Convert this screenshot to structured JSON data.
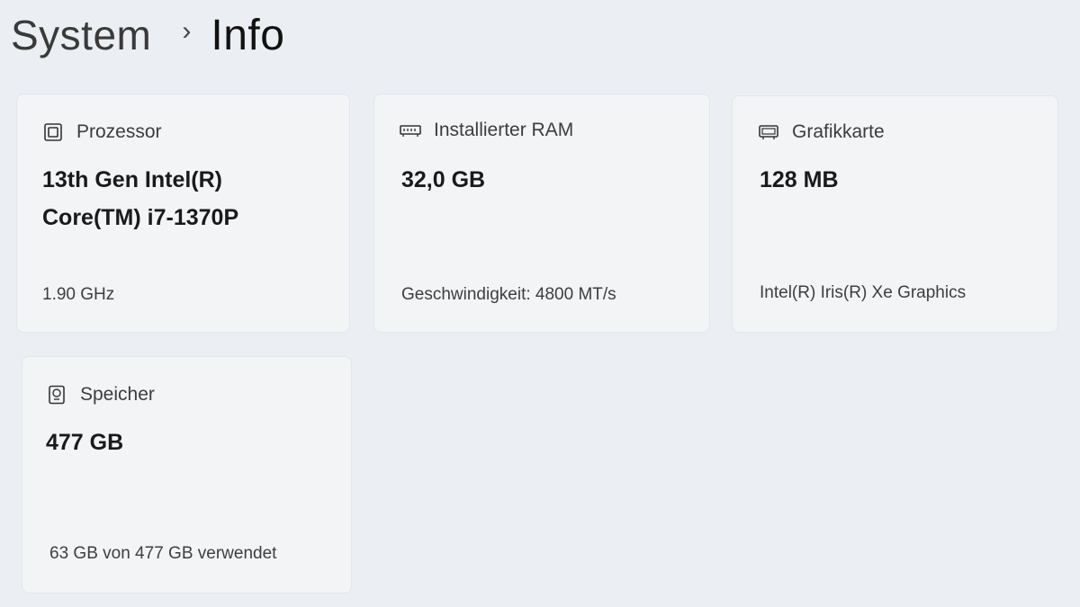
{
  "breadcrumb": {
    "parent": "System",
    "separator": "›",
    "current": "Info"
  },
  "cards": {
    "processor": {
      "icon": "processor-icon",
      "label": "Prozessor",
      "value": "13th Gen Intel(R)\nCore(TM) i7-1370P",
      "detail": "1.90 GHz"
    },
    "ram": {
      "icon": "ram-icon",
      "label": "Installierter RAM",
      "value": "32,0 GB",
      "detail": "Geschwindigkeit: 4800 MT/s"
    },
    "gpu": {
      "icon": "graphics-card-icon",
      "label": "Grafikkarte",
      "value": "128 MB",
      "detail": "Intel(R) Iris(R) Xe Graphics"
    },
    "storage": {
      "icon": "storage-icon",
      "label": "Speicher",
      "value": "477 GB",
      "detail": "63 GB von 477 GB verwendet"
    }
  }
}
